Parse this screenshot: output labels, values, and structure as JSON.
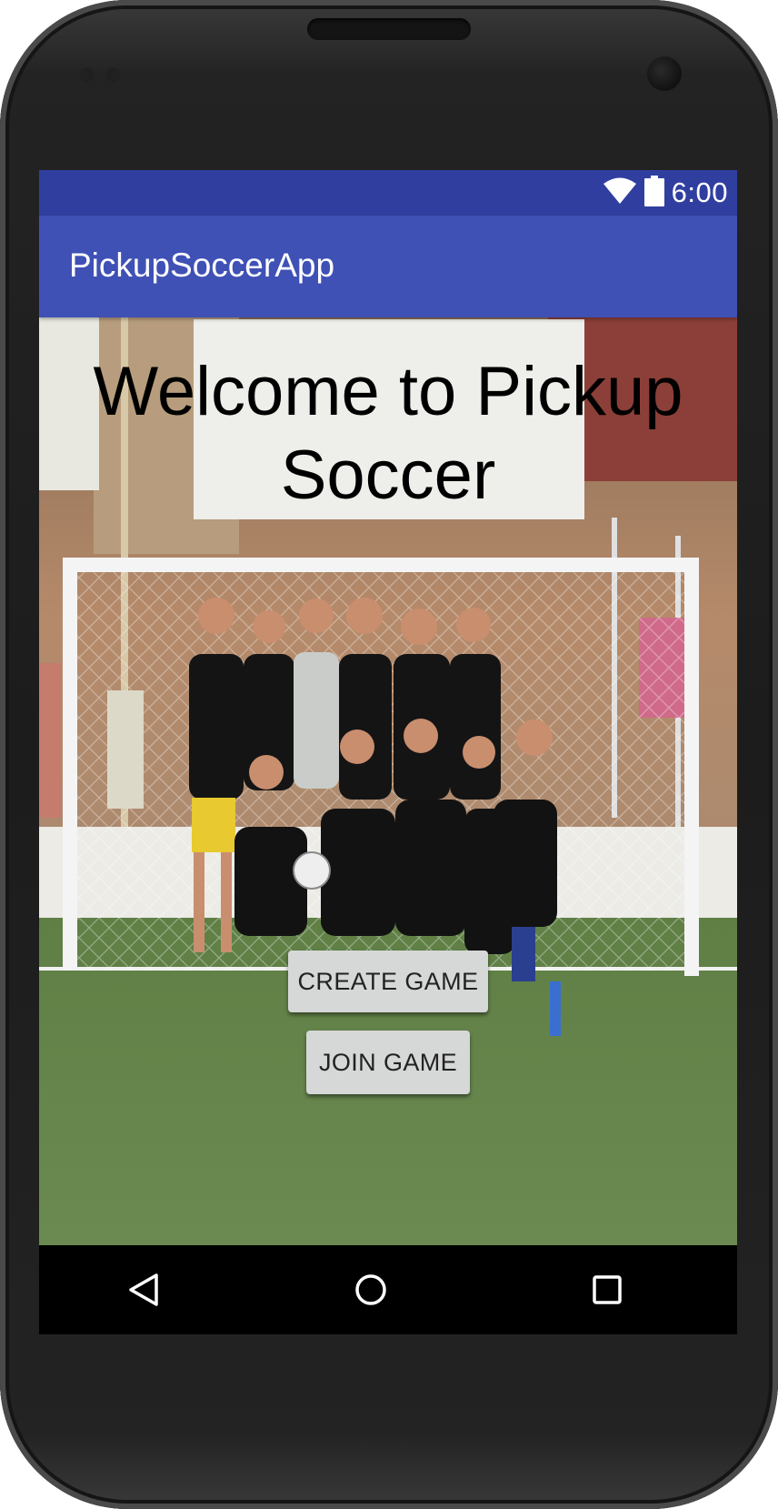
{
  "status_bar": {
    "time": "6:00",
    "icons": [
      "wifi-icon",
      "battery-icon"
    ]
  },
  "app_bar": {
    "title": "PickupSoccerApp"
  },
  "main": {
    "welcome_text": "Welcome to Pickup Soccer",
    "background": "team-photo",
    "buttons": {
      "create_game": "CREATE GAME",
      "join_game": "JOIN GAME"
    }
  },
  "nav_bar": {
    "icons": [
      "back-icon",
      "home-icon",
      "recents-icon"
    ]
  },
  "colors": {
    "status_bar": "#303f9f",
    "app_bar": "#3f51b5",
    "button_bg": "#d6d7d7",
    "nav_bar": "#000000"
  }
}
